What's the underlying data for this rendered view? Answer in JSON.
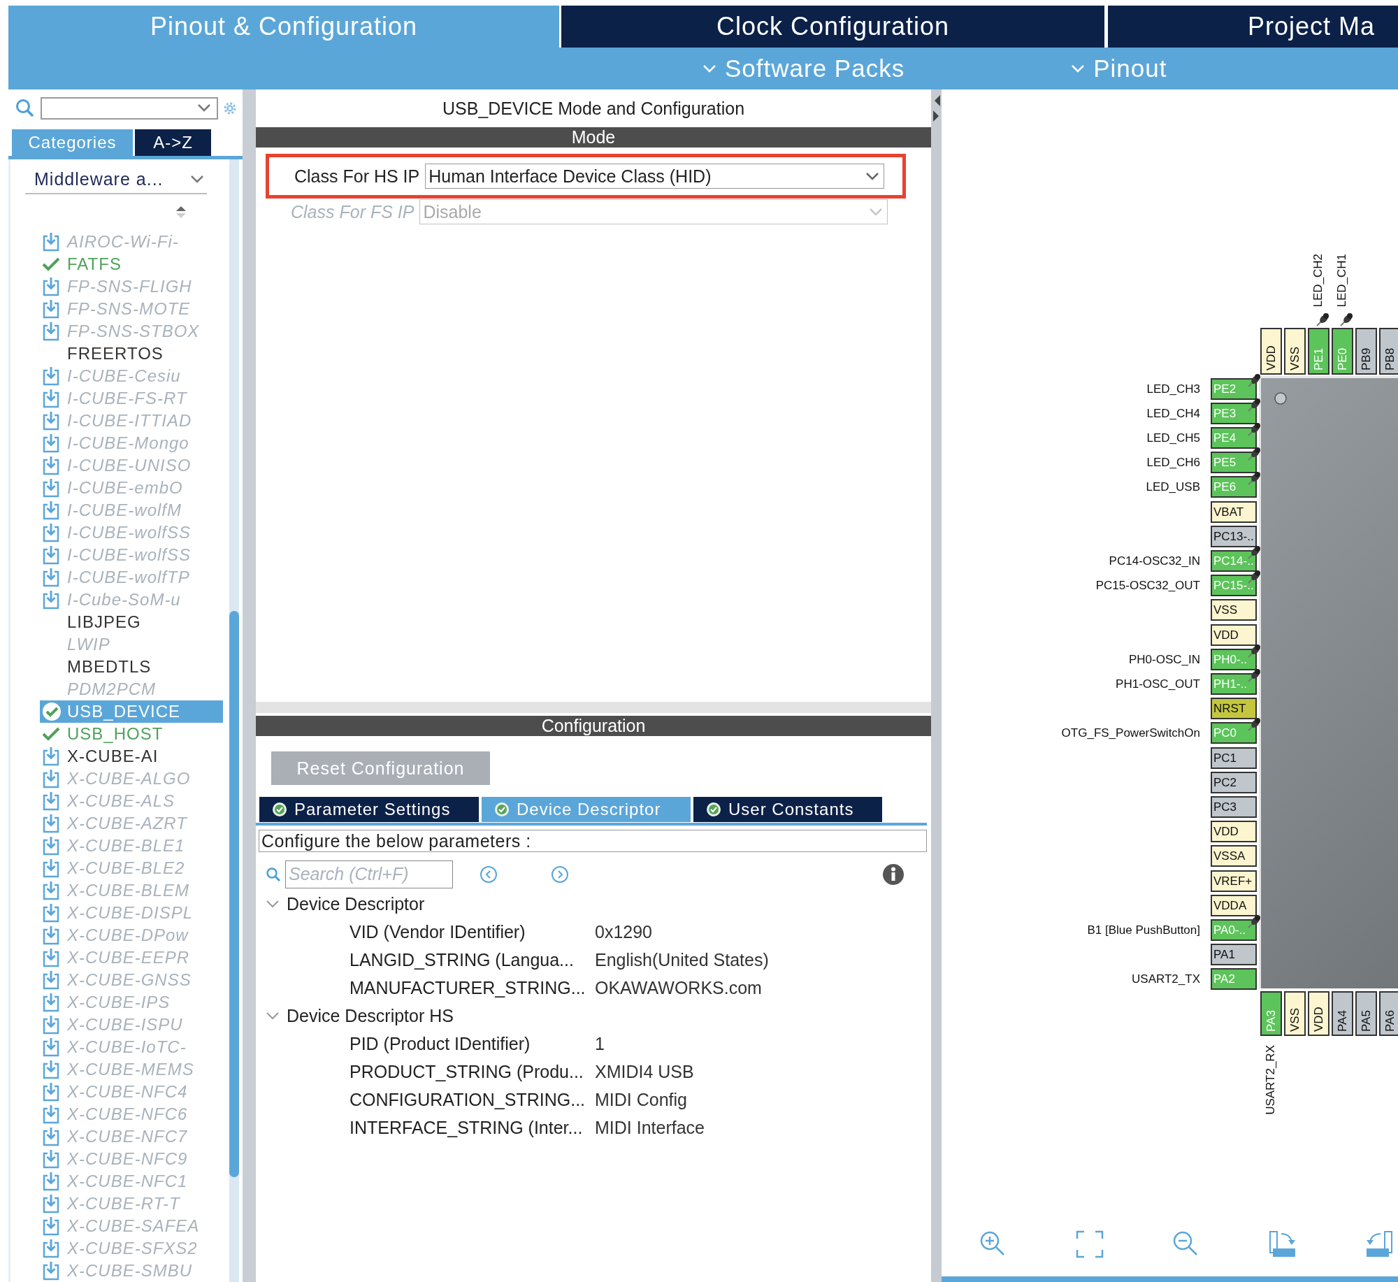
{
  "top_tabs": [
    {
      "label": "Pinout & Configuration",
      "selected": true
    },
    {
      "label": "Clock Configuration",
      "selected": false
    },
    {
      "label": "Project Ma",
      "selected": false
    }
  ],
  "sub_menu": [
    {
      "label": "Software Packs"
    },
    {
      "label": "Pinout"
    }
  ],
  "sidebar": {
    "view_tabs": [
      {
        "label": "Categories",
        "selected": true
      },
      {
        "label": "A->Z",
        "selected": false
      }
    ],
    "category": "Middleware a...",
    "items": [
      {
        "label": "AIROC-Wi-Fi-",
        "kind": "download",
        "enabled": false,
        "disabled": true,
        "selected": false
      },
      {
        "label": "FATFS",
        "kind": "check",
        "enabled": true,
        "disabled": false,
        "selected": false
      },
      {
        "label": "FP-SNS-FLIGH",
        "kind": "download",
        "enabled": false,
        "disabled": true,
        "selected": false
      },
      {
        "label": "FP-SNS-MOTE",
        "kind": "download",
        "enabled": false,
        "disabled": true,
        "selected": false
      },
      {
        "label": "FP-SNS-STBOX",
        "kind": "download",
        "enabled": false,
        "disabled": true,
        "selected": false
      },
      {
        "label": "FREERTOS",
        "kind": "none",
        "enabled": false,
        "disabled": false,
        "selected": false
      },
      {
        "label": "I-CUBE-Cesiu",
        "kind": "download",
        "enabled": false,
        "disabled": true,
        "selected": false
      },
      {
        "label": "I-CUBE-FS-RT",
        "kind": "download",
        "enabled": false,
        "disabled": true,
        "selected": false
      },
      {
        "label": "I-CUBE-ITTIAD",
        "kind": "download",
        "enabled": false,
        "disabled": true,
        "selected": false
      },
      {
        "label": "I-CUBE-Mongo",
        "kind": "download",
        "enabled": false,
        "disabled": true,
        "selected": false
      },
      {
        "label": "I-CUBE-UNISO",
        "kind": "download",
        "enabled": false,
        "disabled": true,
        "selected": false
      },
      {
        "label": "I-CUBE-embO",
        "kind": "download",
        "enabled": false,
        "disabled": true,
        "selected": false
      },
      {
        "label": "I-CUBE-wolfM",
        "kind": "download",
        "enabled": false,
        "disabled": true,
        "selected": false
      },
      {
        "label": "I-CUBE-wolfSS",
        "kind": "download",
        "enabled": false,
        "disabled": true,
        "selected": false
      },
      {
        "label": "I-CUBE-wolfSS",
        "kind": "download",
        "enabled": false,
        "disabled": true,
        "selected": false
      },
      {
        "label": "I-CUBE-wolfTP",
        "kind": "download",
        "enabled": false,
        "disabled": true,
        "selected": false
      },
      {
        "label": "I-Cube-SoM-u",
        "kind": "download",
        "enabled": false,
        "disabled": true,
        "selected": false
      },
      {
        "label": "LIBJPEG",
        "kind": "none",
        "enabled": false,
        "disabled": false,
        "selected": false
      },
      {
        "label": "LWIP",
        "kind": "none",
        "enabled": false,
        "disabled": true,
        "selected": false
      },
      {
        "label": "MBEDTLS",
        "kind": "none",
        "enabled": false,
        "disabled": false,
        "selected": false
      },
      {
        "label": "PDM2PCM",
        "kind": "none",
        "enabled": false,
        "disabled": true,
        "selected": false
      },
      {
        "label": "USB_DEVICE",
        "kind": "check",
        "enabled": true,
        "disabled": false,
        "selected": true
      },
      {
        "label": "USB_HOST",
        "kind": "check",
        "enabled": true,
        "disabled": false,
        "selected": false
      },
      {
        "label": "X-CUBE-AI",
        "kind": "download",
        "enabled": false,
        "disabled": false,
        "selected": false
      },
      {
        "label": "X-CUBE-ALGO",
        "kind": "download",
        "enabled": false,
        "disabled": true,
        "selected": false
      },
      {
        "label": "X-CUBE-ALS",
        "kind": "download",
        "enabled": false,
        "disabled": true,
        "selected": false
      },
      {
        "label": "X-CUBE-AZRT",
        "kind": "download",
        "enabled": false,
        "disabled": true,
        "selected": false
      },
      {
        "label": "X-CUBE-BLE1",
        "kind": "download",
        "enabled": false,
        "disabled": true,
        "selected": false
      },
      {
        "label": "X-CUBE-BLE2",
        "kind": "download",
        "enabled": false,
        "disabled": true,
        "selected": false
      },
      {
        "label": "X-CUBE-BLEM",
        "kind": "download",
        "enabled": false,
        "disabled": true,
        "selected": false
      },
      {
        "label": "X-CUBE-DISPL",
        "kind": "download",
        "enabled": false,
        "disabled": true,
        "selected": false
      },
      {
        "label": "X-CUBE-DPow",
        "kind": "download",
        "enabled": false,
        "disabled": true,
        "selected": false
      },
      {
        "label": "X-CUBE-EEPR",
        "kind": "download",
        "enabled": false,
        "disabled": true,
        "selected": false
      },
      {
        "label": "X-CUBE-GNSS",
        "kind": "download",
        "enabled": false,
        "disabled": true,
        "selected": false
      },
      {
        "label": "X-CUBE-IPS",
        "kind": "download",
        "enabled": false,
        "disabled": true,
        "selected": false
      },
      {
        "label": "X-CUBE-ISPU",
        "kind": "download",
        "enabled": false,
        "disabled": true,
        "selected": false
      },
      {
        "label": "X-CUBE-IoTC-",
        "kind": "download",
        "enabled": false,
        "disabled": true,
        "selected": false
      },
      {
        "label": "X-CUBE-MEMS",
        "kind": "download",
        "enabled": false,
        "disabled": true,
        "selected": false
      },
      {
        "label": "X-CUBE-NFC4",
        "kind": "download",
        "enabled": false,
        "disabled": true,
        "selected": false
      },
      {
        "label": "X-CUBE-NFC6",
        "kind": "download",
        "enabled": false,
        "disabled": true,
        "selected": false
      },
      {
        "label": "X-CUBE-NFC7",
        "kind": "download",
        "enabled": false,
        "disabled": true,
        "selected": false
      },
      {
        "label": "X-CUBE-NFC9",
        "kind": "download",
        "enabled": false,
        "disabled": true,
        "selected": false
      },
      {
        "label": "X-CUBE-NFC1",
        "kind": "download",
        "enabled": false,
        "disabled": true,
        "selected": false
      },
      {
        "label": "X-CUBE-RT-T",
        "kind": "download",
        "enabled": false,
        "disabled": true,
        "selected": false
      },
      {
        "label": "X-CUBE-SAFEA",
        "kind": "download",
        "enabled": false,
        "disabled": true,
        "selected": false
      },
      {
        "label": "X-CUBE-SFXS2",
        "kind": "download",
        "enabled": false,
        "disabled": true,
        "selected": false
      },
      {
        "label": "X-CUBE-SMBU",
        "kind": "download",
        "enabled": false,
        "disabled": true,
        "selected": false
      }
    ]
  },
  "mode_panel": {
    "title": "USB_DEVICE Mode and Configuration",
    "header": "Mode",
    "fields": [
      {
        "label": "Class For HS IP",
        "value": "Human Interface Device Class (HID)",
        "disabled": false,
        "highlighted": true
      },
      {
        "label": "Class For FS IP",
        "value": "Disable",
        "disabled": true,
        "highlighted": false
      }
    ]
  },
  "config_panel": {
    "header": "Configuration",
    "reset_button": "Reset Configuration",
    "tabs": [
      {
        "label": "Parameter Settings",
        "selected": false
      },
      {
        "label": "Device Descriptor",
        "selected": true
      },
      {
        "label": "User Constants",
        "selected": false
      }
    ],
    "hint": "Configure the below parameters :",
    "search": {
      "placeholder": "Search (Ctrl+F)"
    },
    "groups": [
      {
        "title": "Device Descriptor",
        "expanded": true,
        "rows": [
          {
            "key": "VID (Vendor IDentifier)",
            "value": "0x1290"
          },
          {
            "key": "LANGID_STRING (Langua...",
            "value": "English(United States)"
          },
          {
            "key": "MANUFACTURER_STRING...",
            "value": "OKAWAWORKS.com"
          }
        ]
      },
      {
        "title": "Device Descriptor HS",
        "expanded": true,
        "rows": [
          {
            "key": "PID (Product IDentifier)",
            "value": "1"
          },
          {
            "key": "PRODUCT_STRING (Produ...",
            "value": "XMIDI4 USB"
          },
          {
            "key": "CONFIGURATION_STRING...",
            "value": "MIDI Config"
          },
          {
            "key": "INTERFACE_STRING (Inter...",
            "value": "MIDI Interface"
          }
        ]
      }
    ]
  },
  "pinout": {
    "top_pins": [
      {
        "name": "VDD",
        "kind": "power",
        "pinned": false
      },
      {
        "name": "VSS",
        "kind": "power",
        "pinned": false
      },
      {
        "name": "PE1",
        "kind": "assigned",
        "label": "LED_CH2",
        "pinned": true
      },
      {
        "name": "PE0",
        "kind": "assigned",
        "label": "LED_CH1",
        "pinned": true
      },
      {
        "name": "PB9",
        "kind": "unused",
        "pinned": false
      },
      {
        "name": "PB8",
        "kind": "unused",
        "pinned": false
      }
    ],
    "left_pins": [
      {
        "name": "PE2",
        "kind": "assigned",
        "label": "LED_CH3",
        "pinned": true
      },
      {
        "name": "PE3",
        "kind": "assigned",
        "label": "LED_CH4",
        "pinned": true
      },
      {
        "name": "PE4",
        "kind": "assigned",
        "label": "LED_CH5",
        "pinned": true
      },
      {
        "name": "PE5",
        "kind": "assigned",
        "label": "LED_CH6",
        "pinned": true
      },
      {
        "name": "PE6",
        "kind": "assigned",
        "label": "LED_USB",
        "pinned": true
      },
      {
        "name": "VBAT",
        "kind": "power",
        "pinned": false
      },
      {
        "name": "PC13-..",
        "kind": "unused",
        "pinned": false
      },
      {
        "name": "PC14-..",
        "kind": "assigned",
        "label": "PC14-OSC32_IN",
        "pinned": true
      },
      {
        "name": "PC15-..",
        "kind": "assigned",
        "label": "PC15-OSC32_OUT",
        "pinned": true
      },
      {
        "name": "VSS",
        "kind": "power",
        "pinned": false
      },
      {
        "name": "VDD",
        "kind": "power",
        "pinned": false
      },
      {
        "name": "PH0-..",
        "kind": "assigned",
        "label": "PH0-OSC_IN",
        "pinned": true
      },
      {
        "name": "PH1-..",
        "kind": "assigned",
        "label": "PH1-OSC_OUT",
        "pinned": true
      },
      {
        "name": "NRST",
        "kind": "reset",
        "pinned": false
      },
      {
        "name": "PC0",
        "kind": "assigned",
        "label": "OTG_FS_PowerSwitchOn",
        "pinned": true
      },
      {
        "name": "PC1",
        "kind": "unused",
        "pinned": false
      },
      {
        "name": "PC2",
        "kind": "unused",
        "pinned": false
      },
      {
        "name": "PC3",
        "kind": "unused",
        "pinned": false
      },
      {
        "name": "VDD",
        "kind": "power",
        "pinned": false
      },
      {
        "name": "VSSA",
        "kind": "power",
        "pinned": false
      },
      {
        "name": "VREF+",
        "kind": "power",
        "pinned": false
      },
      {
        "name": "VDDA",
        "kind": "power",
        "pinned": false
      },
      {
        "name": "PA0-..",
        "kind": "assigned",
        "label": "B1 [Blue PushButton]",
        "pinned": true
      },
      {
        "name": "PA1",
        "kind": "unused",
        "pinned": false
      },
      {
        "name": "PA2",
        "kind": "assigned",
        "label": "USART2_TX",
        "pinned": false
      }
    ],
    "bottom_pins": [
      {
        "name": "PA3",
        "kind": "assigned",
        "label": "USART2_RX",
        "pinned": false
      },
      {
        "name": "VSS",
        "kind": "power",
        "pinned": false
      },
      {
        "name": "VDD",
        "kind": "power",
        "pinned": false
      },
      {
        "name": "PA4",
        "kind": "unused",
        "pinned": false
      },
      {
        "name": "PA5",
        "kind": "unused",
        "pinned": false
      },
      {
        "name": "PA6",
        "kind": "unused",
        "pinned": false
      }
    ]
  }
}
